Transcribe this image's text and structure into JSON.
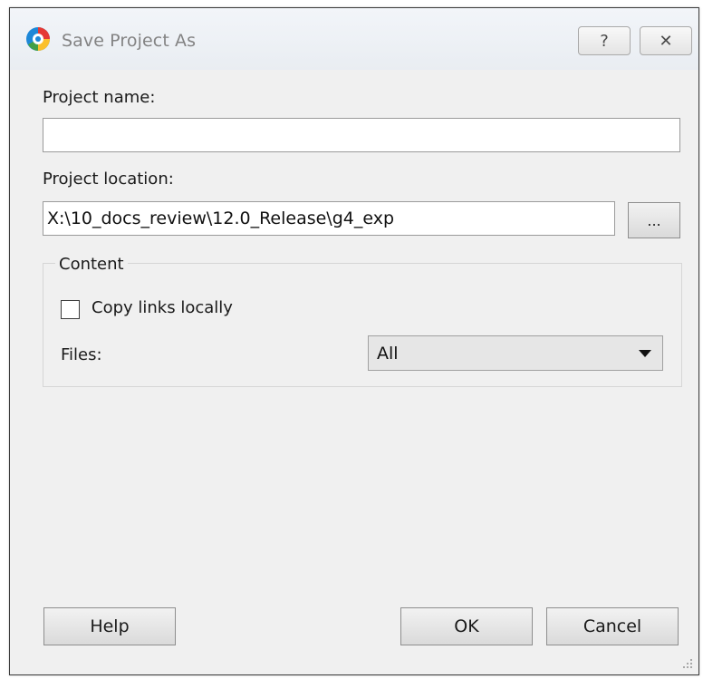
{
  "dialog": {
    "title": "Save Project As",
    "help_button_symbol": "?",
    "close_button_symbol": "✕",
    "app_icon": "app-logo-icon"
  },
  "form": {
    "project_name_label": "Project name:",
    "project_name_value": "",
    "project_location_label": "Project location:",
    "project_location_value": "X:\\10_docs_review\\12.0_Release\\g4_exp",
    "browse_button_label": "..."
  },
  "content_group": {
    "title": "Content",
    "copy_links_label": "Copy links locally",
    "copy_links_checked": false,
    "files_label": "Files:",
    "files_selected": "All"
  },
  "buttons": {
    "help": "Help",
    "ok": "OK",
    "cancel": "Cancel"
  },
  "colors": {
    "dialog_background": "#f0f0f0",
    "title_text": "#838383",
    "border": "#3c3c3c"
  }
}
